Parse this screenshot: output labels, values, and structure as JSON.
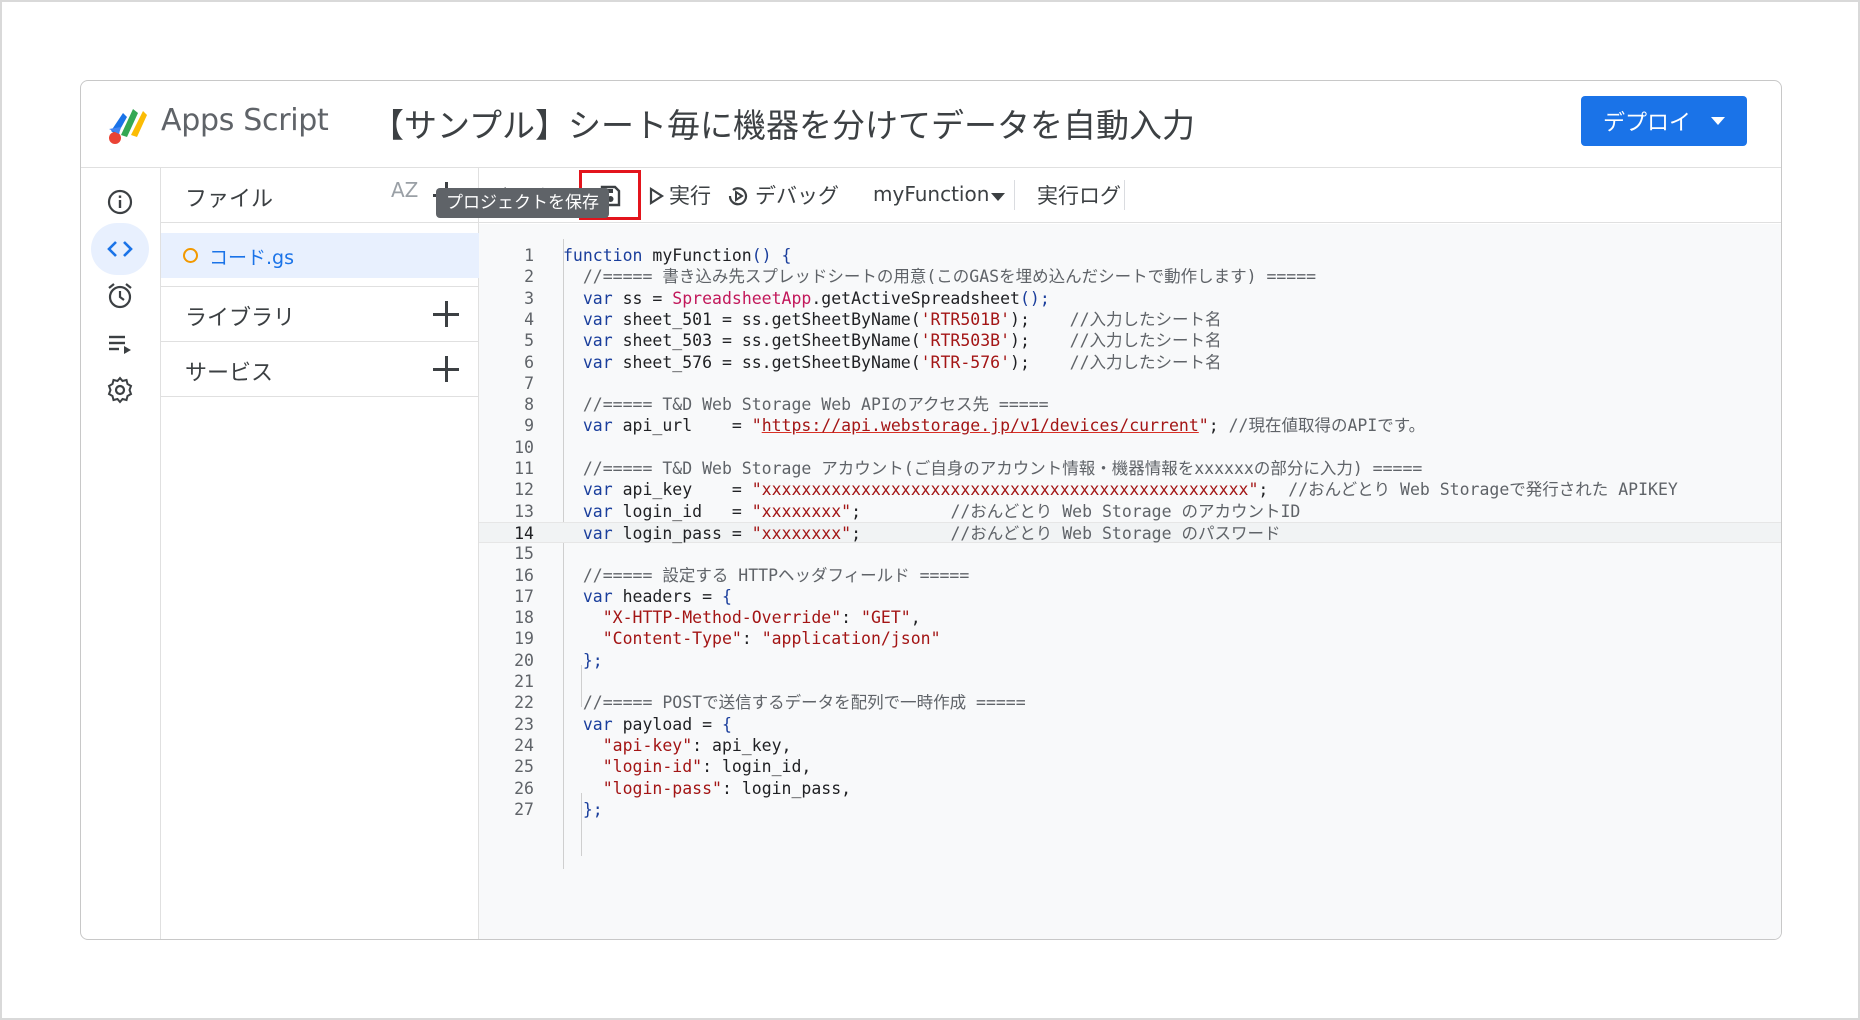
{
  "header": {
    "app_name": "Apps Script",
    "project_title": "【サンプル】シート毎に機器を分けてデータを自動入力",
    "deploy_label": "デプロイ"
  },
  "files_panel": {
    "files_label": "ファイル",
    "sort_label": "AZ",
    "file_name": "コード.gs",
    "libraries_label": "ライブラリ",
    "services_label": "サービス"
  },
  "toolbar": {
    "run_label": "実行",
    "debug_label": "デバッグ",
    "function_name": "myFunction",
    "log_label": "実行ログ",
    "save_tooltip": "プロジェクトを保存"
  },
  "icons": {
    "rail": [
      "info-icon",
      "code-icon",
      "alarm-clock-icon",
      "executions-icon",
      "gear-icon"
    ],
    "toolbar": [
      "undo-icon",
      "redo-icon",
      "save-icon",
      "play-icon",
      "debug-icon"
    ]
  },
  "colors": {
    "accent": "#1a73e8",
    "highlight_box": "#e3141c",
    "active_file_bg": "#e8f0fe",
    "file_dot": "#f29900"
  },
  "editor": {
    "current_line": 14,
    "lines": [
      {
        "n": "1",
        "parts": [
          {
            "t": "function ",
            "c": "c-kw"
          },
          {
            "t": "myFunction",
            "c": "c-pl"
          },
          {
            "t": "() {",
            "c": "c-kw"
          }
        ]
      },
      {
        "n": "2",
        "parts": [
          {
            "t": "  //===== 書き込み先スプレッドシートの用意(このGASを埋め込んだシートで動作します) =====",
            "c": "c-cm"
          }
        ]
      },
      {
        "n": "3",
        "parts": [
          {
            "t": "  var ",
            "c": "c-kw"
          },
          {
            "t": "ss = ",
            "c": "c-pl"
          },
          {
            "t": "SpreadsheetApp",
            "c": "c-cls"
          },
          {
            "t": ".getActiveSpreadsheet",
            "c": "c-pl"
          },
          {
            "t": "();",
            "c": "c-kw"
          }
        ]
      },
      {
        "n": "4",
        "parts": [
          {
            "t": "  var ",
            "c": "c-kw"
          },
          {
            "t": "sheet_501 = ss.getSheetByName(",
            "c": "c-pl"
          },
          {
            "t": "'RTR501B'",
            "c": "c-str"
          },
          {
            "t": ");    ",
            "c": "c-pl"
          },
          {
            "t": "//入力したシート名",
            "c": "c-cm"
          }
        ]
      },
      {
        "n": "5",
        "parts": [
          {
            "t": "  var ",
            "c": "c-kw"
          },
          {
            "t": "sheet_503 = ss.getSheetByName(",
            "c": "c-pl"
          },
          {
            "t": "'RTR503B'",
            "c": "c-str"
          },
          {
            "t": ");    ",
            "c": "c-pl"
          },
          {
            "t": "//入力したシート名",
            "c": "c-cm"
          }
        ]
      },
      {
        "n": "6",
        "parts": [
          {
            "t": "  var ",
            "c": "c-kw"
          },
          {
            "t": "sheet_576 = ss.getSheetByName(",
            "c": "c-pl"
          },
          {
            "t": "'RTR-576'",
            "c": "c-str"
          },
          {
            "t": ");    ",
            "c": "c-pl"
          },
          {
            "t": "//入力したシート名",
            "c": "c-cm"
          }
        ]
      },
      {
        "n": "7",
        "parts": []
      },
      {
        "n": "8",
        "parts": [
          {
            "t": "  //===== T&D Web Storage Web APIのアクセス先 =====",
            "c": "c-cm"
          }
        ]
      },
      {
        "n": "9",
        "parts": [
          {
            "t": "  var ",
            "c": "c-kw"
          },
          {
            "t": "api_url    = ",
            "c": "c-pl"
          },
          {
            "t": "\"",
            "c": "c-str"
          },
          {
            "t": "https://api.webstorage.jp/v1/devices/current",
            "c": "c-url"
          },
          {
            "t": "\"",
            "c": "c-str"
          },
          {
            "t": "; ",
            "c": "c-pl"
          },
          {
            "t": "//現在値取得のAPIです。",
            "c": "c-cm"
          }
        ]
      },
      {
        "n": "10",
        "parts": []
      },
      {
        "n": "11",
        "parts": [
          {
            "t": "  //===== T&D Web Storage アカウント(ご自身のアカウント情報・機器情報をxxxxxxの部分に入力) =====",
            "c": "c-cm"
          }
        ]
      },
      {
        "n": "12",
        "parts": [
          {
            "t": "  var ",
            "c": "c-kw"
          },
          {
            "t": "api_key    = ",
            "c": "c-pl"
          },
          {
            "t": "\"xxxxxxxxxxxxxxxxxxxxxxxxxxxxxxxxxxxxxxxxxxxxxxxxx\"",
            "c": "c-str"
          },
          {
            "t": ";  ",
            "c": "c-pl"
          },
          {
            "t": "//おんどとり Web Storageで発行された APIKEY",
            "c": "c-cm"
          }
        ]
      },
      {
        "n": "13",
        "parts": [
          {
            "t": "  var ",
            "c": "c-kw"
          },
          {
            "t": "login_id   = ",
            "c": "c-pl"
          },
          {
            "t": "\"xxxxxxxx\"",
            "c": "c-str"
          },
          {
            "t": ";         ",
            "c": "c-pl"
          },
          {
            "t": "//おんどとり Web Storage のアカウントID",
            "c": "c-cm"
          }
        ]
      },
      {
        "n": "14",
        "parts": [
          {
            "t": "  var ",
            "c": "c-kw"
          },
          {
            "t": "login_pass = ",
            "c": "c-pl"
          },
          {
            "t": "\"xxxxxxxx\"",
            "c": "c-str"
          },
          {
            "t": ";         ",
            "c": "c-pl"
          },
          {
            "t": "//おんどとり Web Storage のパスワード",
            "c": "c-cm"
          }
        ]
      },
      {
        "n": "15",
        "parts": []
      },
      {
        "n": "16",
        "parts": [
          {
            "t": "  //===== 設定する HTTPヘッダフィールド =====",
            "c": "c-cm"
          }
        ]
      },
      {
        "n": "17",
        "parts": [
          {
            "t": "  var ",
            "c": "c-kw"
          },
          {
            "t": "headers = ",
            "c": "c-pl"
          },
          {
            "t": "{",
            "c": "c-kw"
          }
        ]
      },
      {
        "n": "18",
        "parts": [
          {
            "t": "    \"X-HTTP-Method-Override\"",
            "c": "c-str"
          },
          {
            "t": ": ",
            "c": "c-pl"
          },
          {
            "t": "\"GET\"",
            "c": "c-str"
          },
          {
            "t": ",",
            "c": "c-pl"
          }
        ]
      },
      {
        "n": "19",
        "parts": [
          {
            "t": "    \"Content-Type\"",
            "c": "c-str"
          },
          {
            "t": ": ",
            "c": "c-pl"
          },
          {
            "t": "\"application/json\"",
            "c": "c-str"
          }
        ]
      },
      {
        "n": "20",
        "parts": [
          {
            "t": "  };",
            "c": "c-kw"
          }
        ]
      },
      {
        "n": "21",
        "parts": []
      },
      {
        "n": "22",
        "parts": [
          {
            "t": "  //===== POSTで送信するデータを配列で一時作成 =====",
            "c": "c-cm"
          }
        ]
      },
      {
        "n": "23",
        "parts": [
          {
            "t": "  var ",
            "c": "c-kw"
          },
          {
            "t": "payload = ",
            "c": "c-pl"
          },
          {
            "t": "{",
            "c": "c-kw"
          }
        ]
      },
      {
        "n": "24",
        "parts": [
          {
            "t": "    \"api-key\"",
            "c": "c-str"
          },
          {
            "t": ": api_key,",
            "c": "c-pl"
          }
        ]
      },
      {
        "n": "25",
        "parts": [
          {
            "t": "    \"login-id\"",
            "c": "c-str"
          },
          {
            "t": ": login_id,",
            "c": "c-pl"
          }
        ]
      },
      {
        "n": "26",
        "parts": [
          {
            "t": "    \"login-pass\"",
            "c": "c-str"
          },
          {
            "t": ": login_pass,",
            "c": "c-pl"
          }
        ]
      },
      {
        "n": "27",
        "parts": [
          {
            "t": "  };",
            "c": "c-kw"
          }
        ]
      }
    ]
  }
}
